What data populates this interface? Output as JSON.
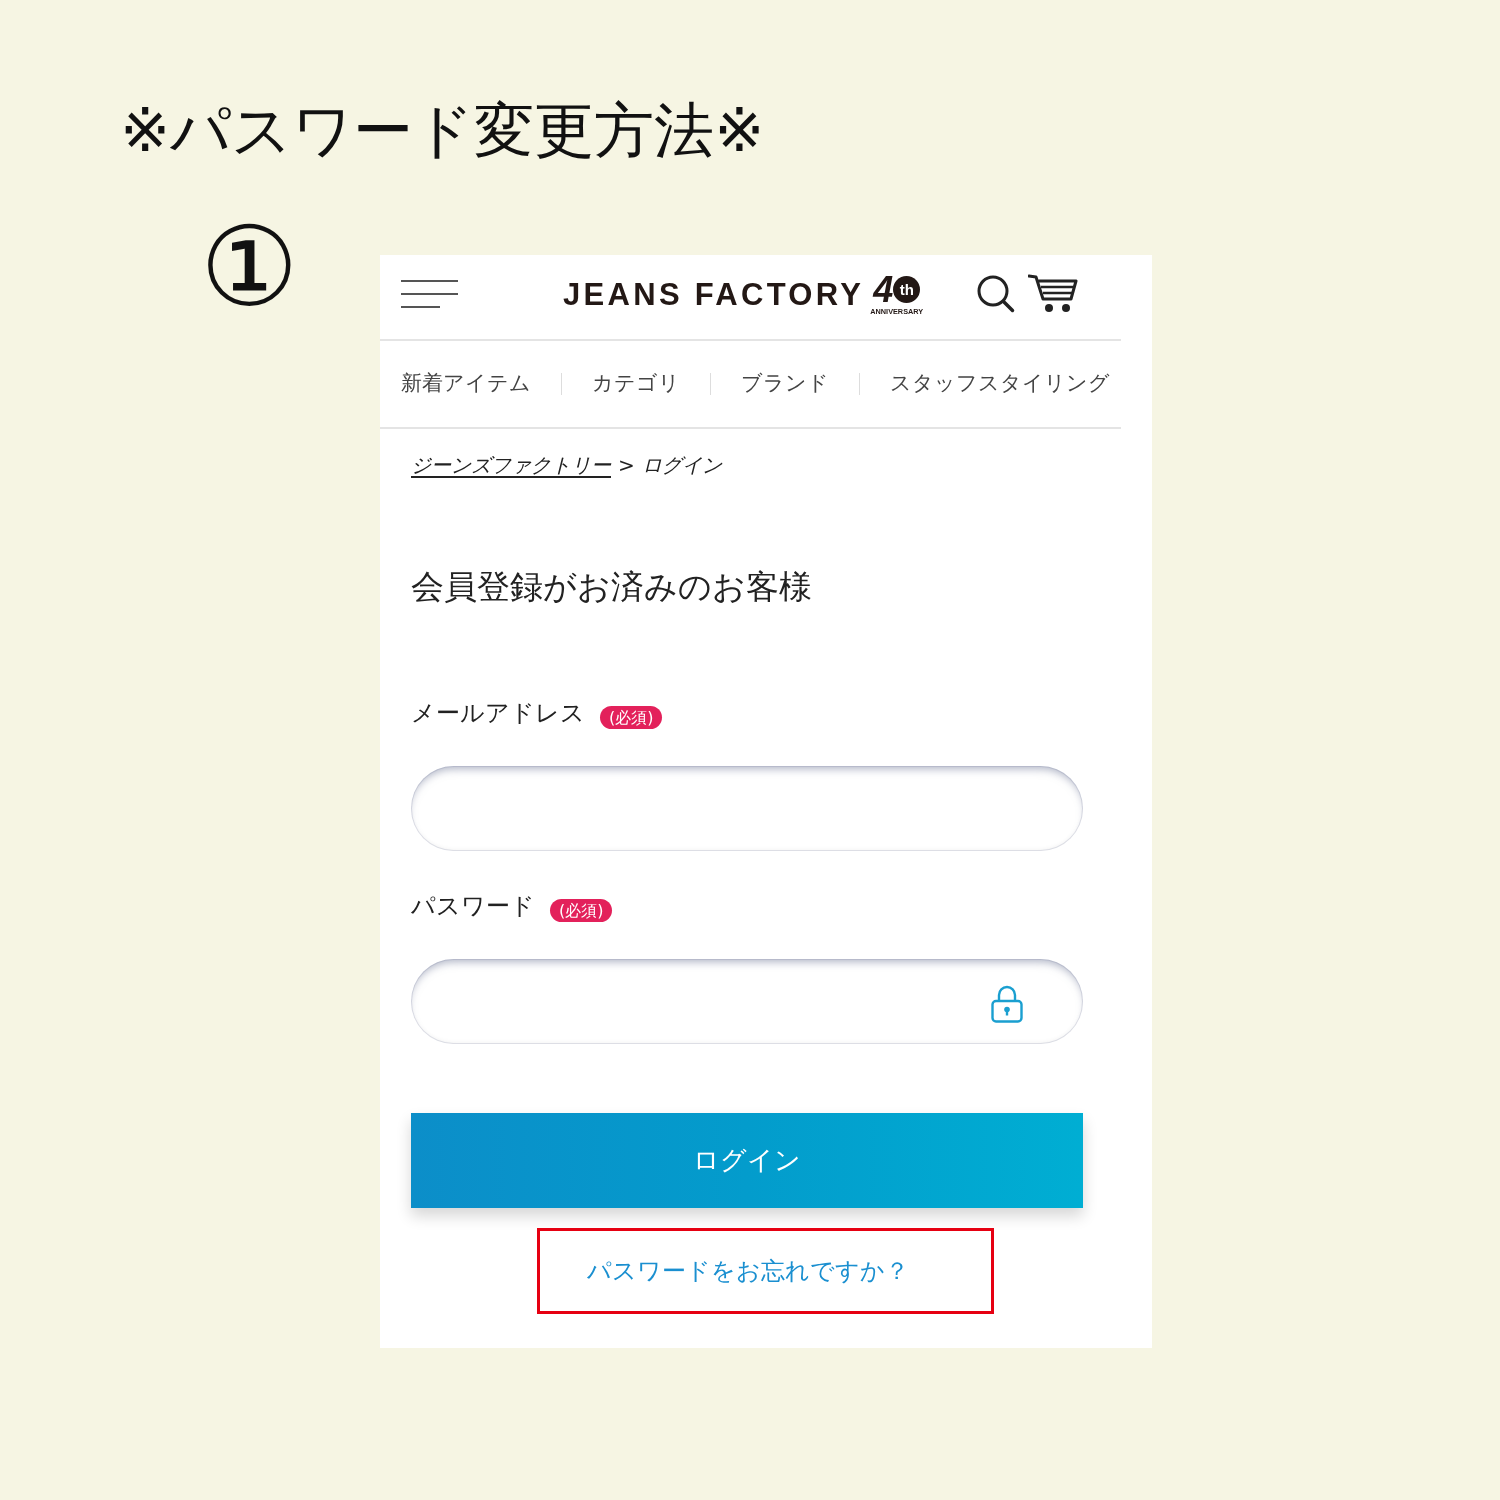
{
  "page": {
    "title": "※パスワード変更方法※",
    "step": "①"
  },
  "header": {
    "logo": {
      "wordmark": "JEANS FACTORY",
      "anniversary_number": "4",
      "anniversary_suffix": "th",
      "anniversary_caption": "ANNIVERSARY"
    }
  },
  "nav": {
    "items": [
      {
        "label": "新着アイテム"
      },
      {
        "label": "カテゴリ"
      },
      {
        "label": "ブランド"
      },
      {
        "label": "スタッフスタイリング"
      }
    ]
  },
  "breadcrumb": {
    "separator": ">",
    "items": [
      {
        "label": "ジーンズファクトリー",
        "kind": "link"
      },
      {
        "label": "ログイン",
        "kind": "current"
      }
    ]
  },
  "login_form": {
    "heading": "会員登録がお済みのお客様",
    "fields": [
      {
        "kind": "email",
        "label": "メールアドレス",
        "required_badge": "(必須)"
      },
      {
        "kind": "password",
        "label": "パスワード",
        "required_badge": "(必須)"
      }
    ],
    "submit": {
      "label": "ログイン"
    },
    "forgot_link": {
      "label": "パスワードをお忘れですか？",
      "highlighted": true
    }
  }
}
